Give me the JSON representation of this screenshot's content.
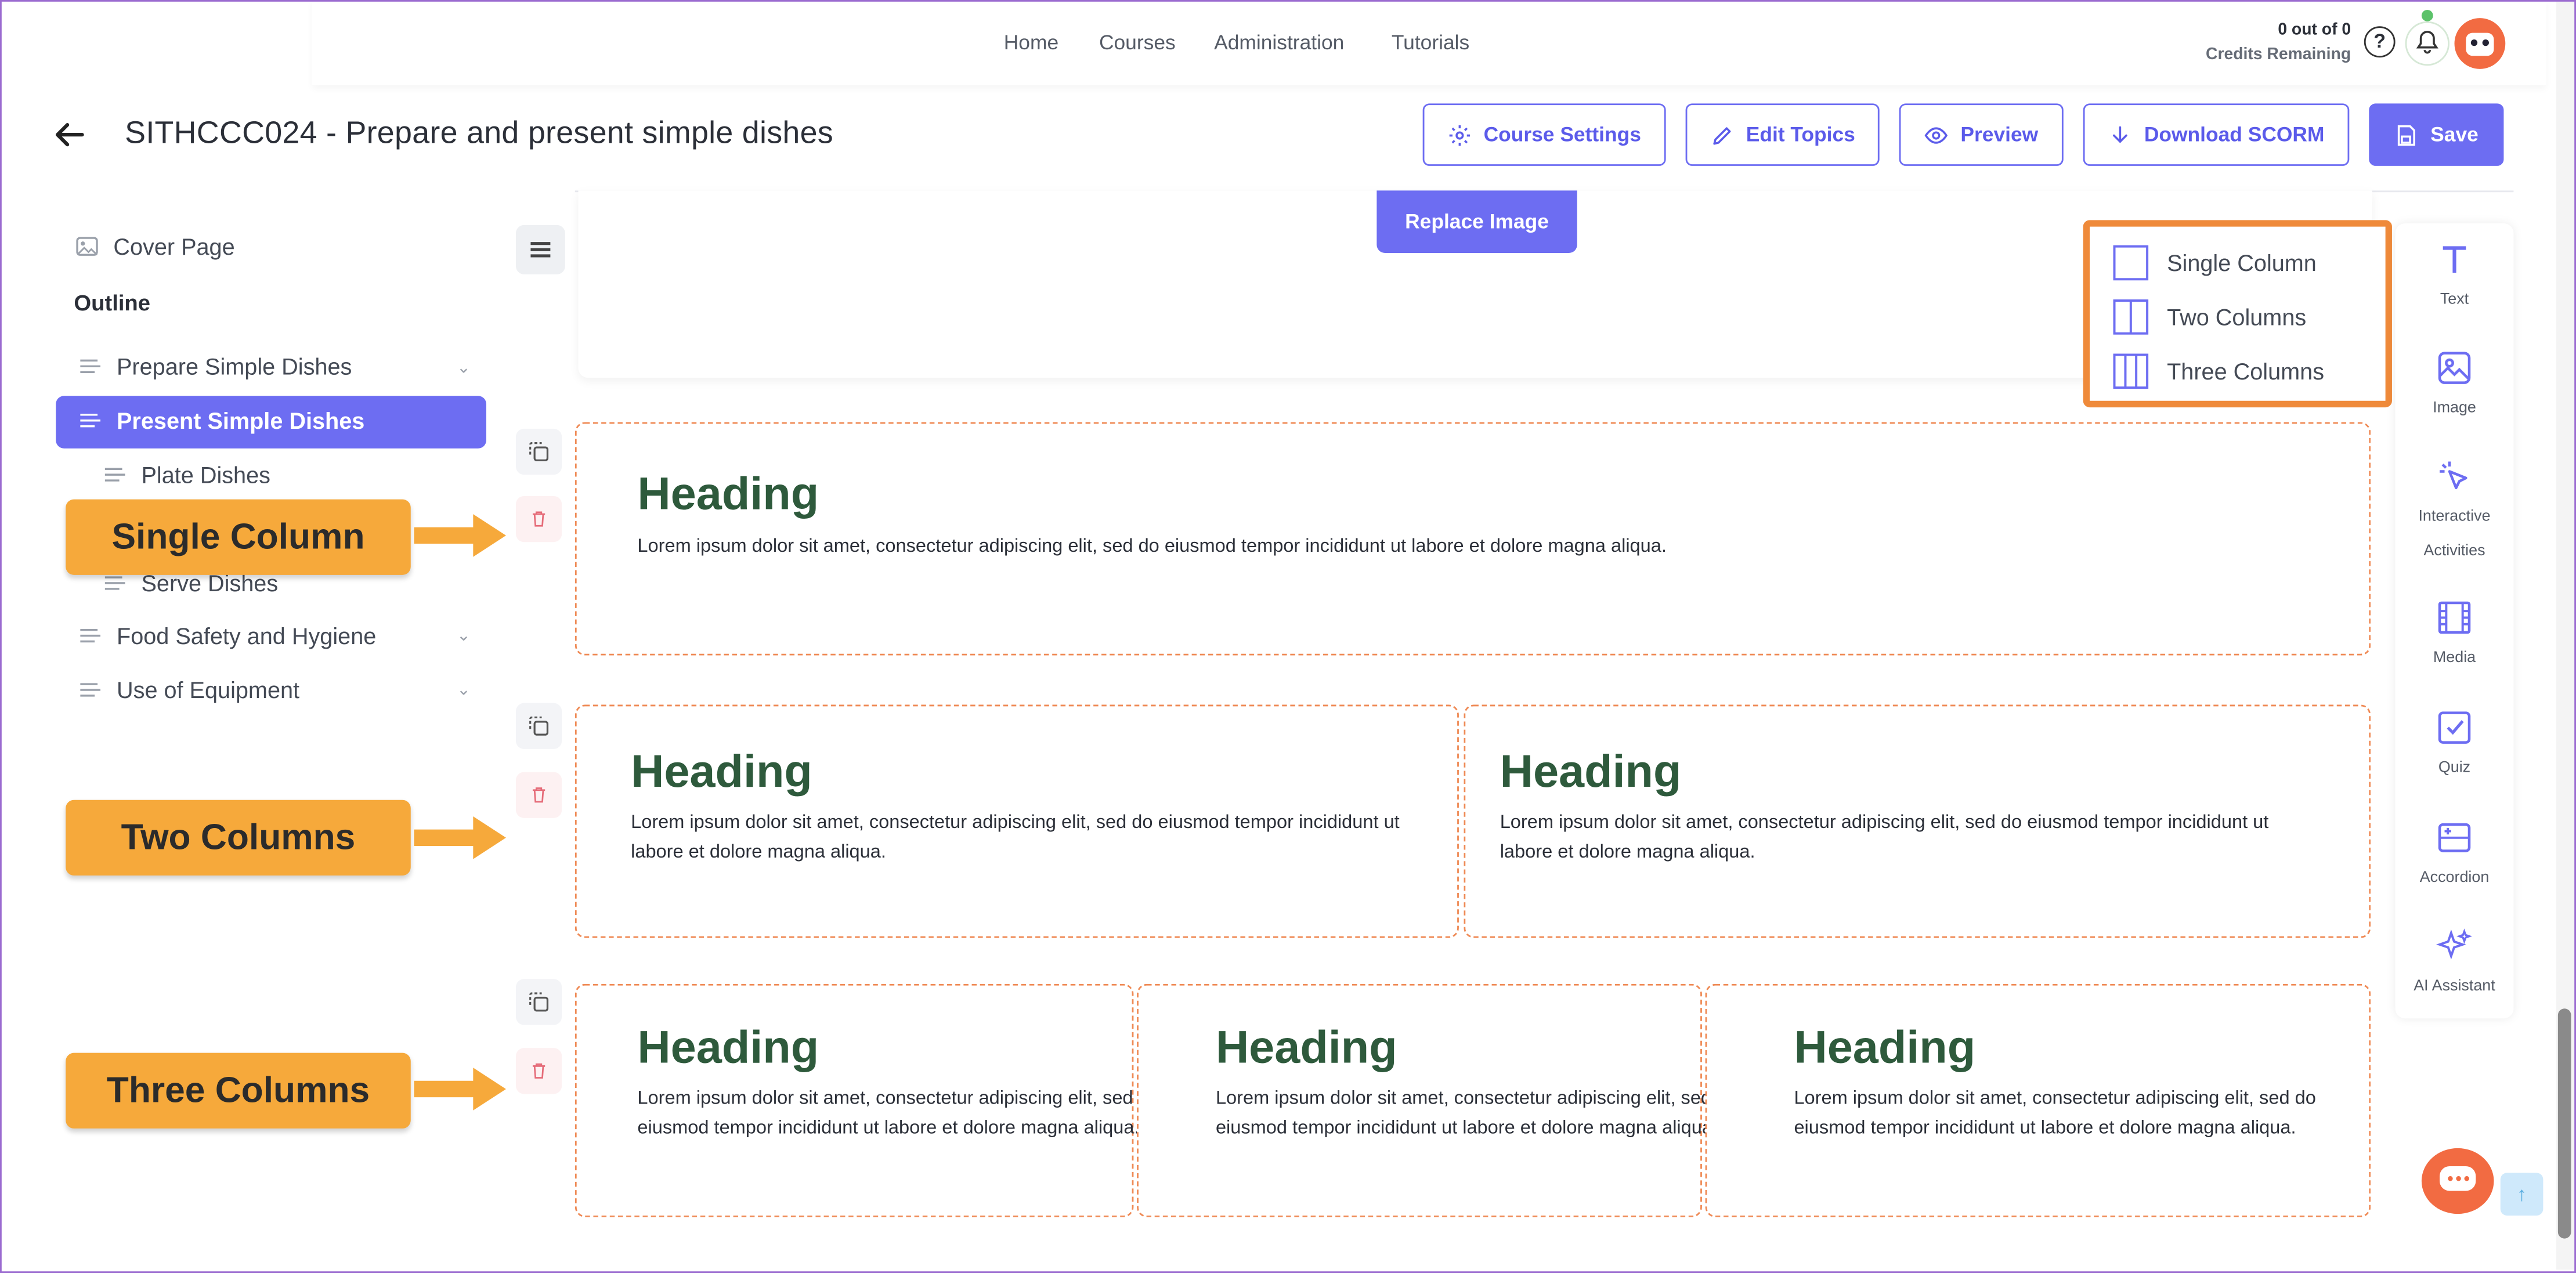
{
  "nav": {
    "links": [
      "Home",
      "Courses",
      "Administration",
      "Tutorials"
    ]
  },
  "credits": {
    "count": "0 out of 0",
    "label": "Credits Remaining"
  },
  "header": {
    "title": "SITHCCC024 - Prepare and present simple dishes",
    "buttons": {
      "course_settings": "Course Settings",
      "edit_topics": "Edit Topics",
      "preview": "Preview",
      "download_scorm": "Download SCORM",
      "save": "Save"
    }
  },
  "sidebar": {
    "cover_page": "Cover Page",
    "outline_label": "Outline",
    "items": [
      {
        "label": "Prepare Simple Dishes",
        "expandable": true
      },
      {
        "label": "Present Simple Dishes",
        "active": true
      },
      {
        "label": "Plate Dishes",
        "sub": true
      },
      {
        "label": "Serve Dishes",
        "sub": true
      },
      {
        "label": "Food Safety and Hygiene",
        "expandable": true
      },
      {
        "label": "Use of Equipment",
        "expandable": true
      }
    ]
  },
  "editor": {
    "replace_image": "Replace Image",
    "single": {
      "heading": "Heading",
      "text": "Lorem ipsum dolor sit amet, consectetur adipiscing elit, sed do eiusmod tempor incididunt ut labore et dolore magna aliqua."
    },
    "two": [
      {
        "heading": "Heading",
        "text": "Lorem ipsum dolor sit amet, consectetur adipiscing elit, sed do eiusmod tempor incididunt ut labore et dolore magna aliqua."
      },
      {
        "heading": "Heading",
        "text": "Lorem ipsum dolor sit amet, consectetur adipiscing elit, sed do eiusmod tempor incididunt ut labore et dolore magna aliqua."
      }
    ],
    "three": [
      {
        "heading": "Heading",
        "text": "Lorem ipsum dolor sit amet, consectetur adipiscing elit, sed do eiusmod tempor incididunt ut labore et dolore magna aliqua."
      },
      {
        "heading": "Heading",
        "text": "Lorem ipsum dolor sit amet, consectetur adipiscing elit, sed do eiusmod tempor incididunt ut labore et dolore magna aliqua."
      },
      {
        "heading": "Heading",
        "text": "Lorem ipsum dolor sit amet, consectetur adipiscing elit, sed do eiusmod tempor incididunt ut labore et dolore magna aliqua."
      }
    ]
  },
  "callouts": {
    "single": "Single Column",
    "two": "Two Columns",
    "three": "Three Columns"
  },
  "layout_menu": {
    "options": [
      "Single Column",
      "Two Columns",
      "Three Columns"
    ]
  },
  "rail": {
    "text": "Text",
    "image": "Image",
    "interactive_1": "Interactive",
    "interactive_2": "Activities",
    "media": "Media",
    "quiz": "Quiz",
    "accordion": "Accordion",
    "ai": "AI Assistant"
  },
  "colors": {
    "accent": "#6d6df2",
    "callout": "#f6a93b",
    "dashed_border": "#ef8a55",
    "heading": "#2e5a3c"
  }
}
